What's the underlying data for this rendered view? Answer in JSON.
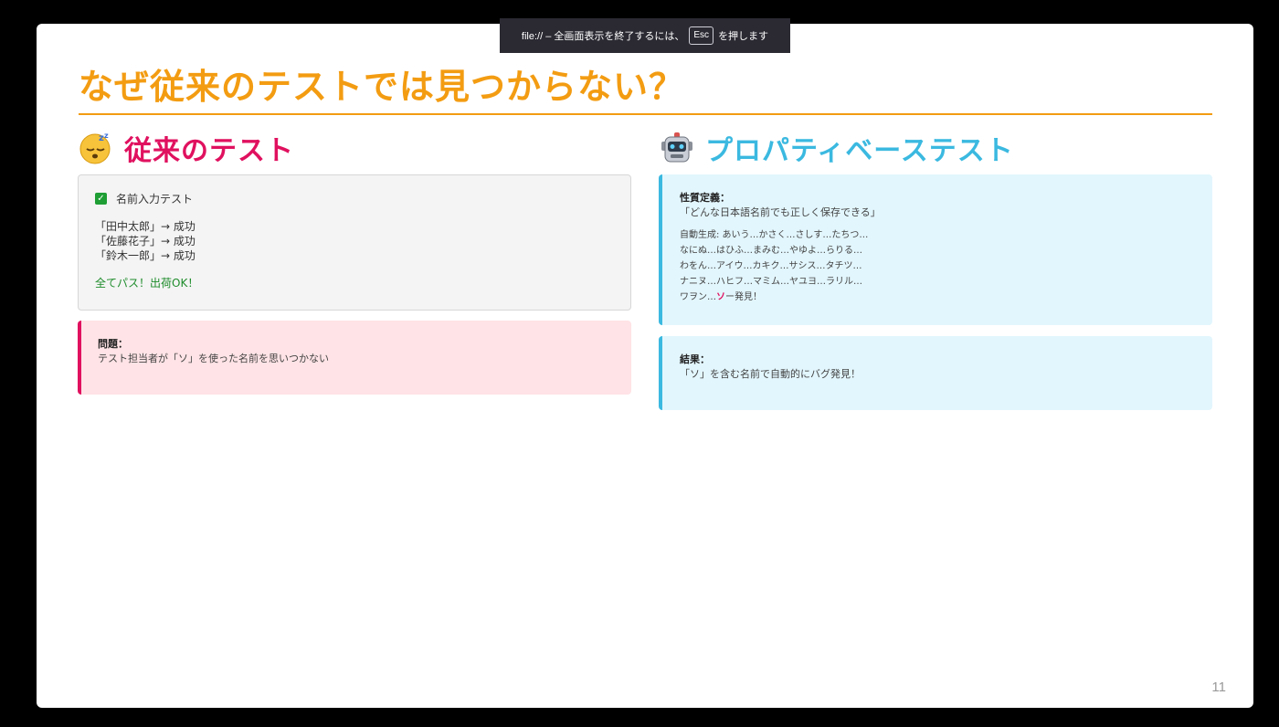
{
  "fullscreen_notice": {
    "before": "file:// – 全画面表示を終了するには、",
    "key": "Esc",
    "after": "を押します"
  },
  "slide": {
    "title": "なぜ従来のテストでは見つからない？",
    "page_number": "11"
  },
  "left": {
    "heading": "従来のテスト",
    "heading_icon": "sleeping-face-icon",
    "test_box": {
      "check_label": "名前入力テスト",
      "cases": [
        "「田中太郎」→ 成功",
        "「佐藤花子」→ 成功",
        "「鈴木一郎」→ 成功"
      ],
      "result": "全てパス！出荷OK！"
    },
    "problem_box": {
      "label": "問題：",
      "text": "テスト担当者が「ソ」を使った名前を思いつかない"
    }
  },
  "right": {
    "heading": "プロパティベーステスト",
    "heading_icon": "robot-face-icon",
    "property_box": {
      "label": "性質定義：",
      "definition": "「どんな日本語名前でも正しく保存できる」",
      "generated": [
        "自動生成: あいう…かさく…さしす…たちつ…",
        "なにぬ…はひふ…まみむ…やゆよ…らりる…",
        "わをん…アイウ…カキク…サシス…タチツ…",
        "ナニヌ…ハヒフ…マミム…ヤユヨ…ラリル…"
      ],
      "last_prefix": "ワヲン…",
      "last_highlight": "ソ",
      "last_suffix": "ー発見！"
    },
    "result_box": {
      "label": "結果：",
      "text": "「ソ」を含む名前で自動的にバグ発見！"
    }
  },
  "colors": {
    "title": "#f39c12",
    "left_heading": "#e0115f",
    "right_heading": "#3bb9e0",
    "ok_text": "#1e8c2b"
  }
}
